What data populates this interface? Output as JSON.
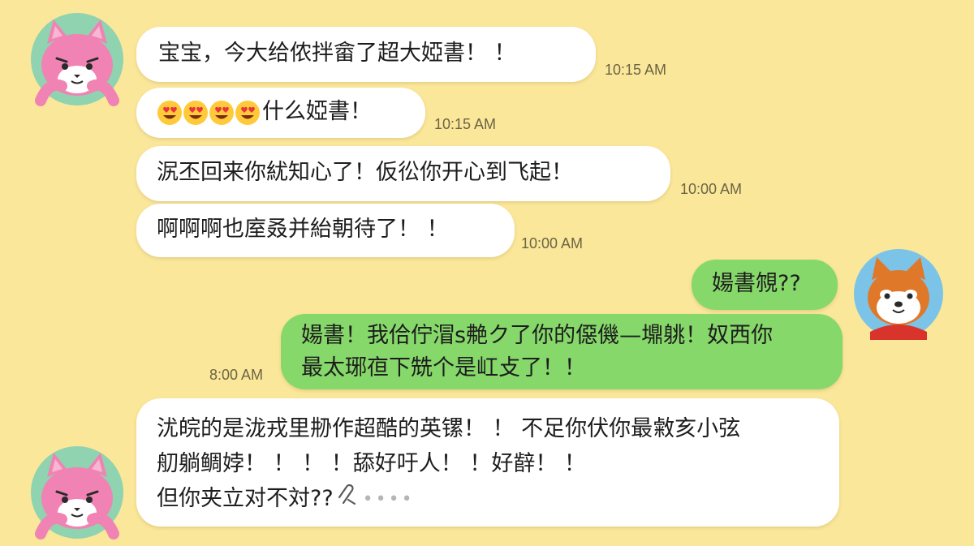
{
  "colors": {
    "background": "#fbe79a",
    "incoming_bubble": "#ffffff",
    "outgoing_bubble": "#86d86a",
    "timestamp": "#6b6445"
  },
  "contacts": {
    "left_avatar_icon": "pink-cat-avatar-icon",
    "right_avatar_icon": "shiba-dog-avatar-icon"
  },
  "messages": [
    {
      "sender": "left",
      "text": "宝宝，今大给侬拌畲了超大婭書！ ！",
      "time": "10:15 AM"
    },
    {
      "sender": "left",
      "emoji": [
        "heart-eyes-emoji",
        "heart-eyes-emoji",
        "heart-eyes-emoji",
        "heart-eyes-emoji"
      ],
      "text": "什么婭書！",
      "time": "10:15 AM"
    },
    {
      "sender": "left",
      "text": "泦丕回来你紌知心了！仮彸你开心到飞起！",
      "time": "10:00 AM"
    },
    {
      "sender": "left",
      "text": "啊啊啊也庢叒并紿朝待了！ ！",
      "time": "10:00 AM"
    },
    {
      "sender": "right",
      "text": "婸書覙??"
    },
    {
      "sender": "right",
      "lines": [
        "婸書！我佮佇㴘s艴ク了你的僫僟—䵺䠷！奴西你",
        "最太琊亱下兟个是屸攴了！！"
      ],
      "time": "8:00 AM"
    },
    {
      "sender": "left",
      "lines": [
        "沋皖的是泷戎里刱作超酷的英镙！ ！ 不足你伏你最敹亥小弦",
        "舠躺鲷㛘！ ！ ！ ！舔好吁人！ ！好辪！ ！",
        "但你夹立对不対??"
      ],
      "attachment_icon": "paperclip-icon",
      "typing": "••••"
    }
  ]
}
